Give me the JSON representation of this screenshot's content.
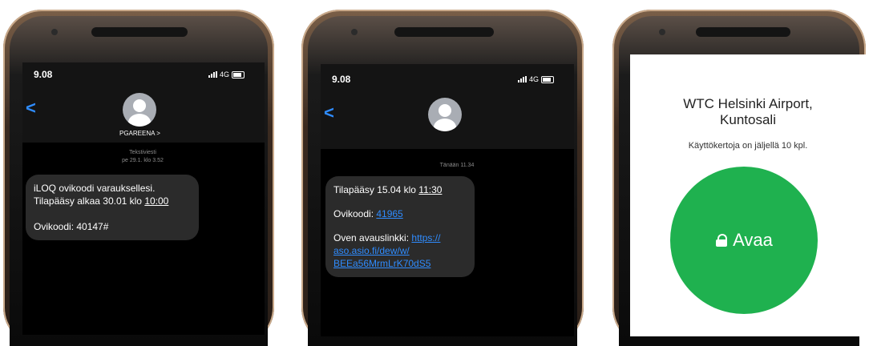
{
  "phones": [
    {
      "time": "9.08",
      "network": "4G",
      "back": "<",
      "sender": "PGAREENA >",
      "meta_line1": "Tekstiviesti",
      "meta_line2": "pe 29.1. klo 3.52",
      "message": {
        "line1": "iLOQ ovikoodi varauksellesi.",
        "line2_prefix": "Tilapääsy alkaa 30.01 klo ",
        "line2_time": "10:00",
        "line3": "Ovikoodi: 40147#"
      }
    },
    {
      "time": "9.08",
      "network": "4G",
      "back": "<",
      "meta_line1": "Tänään 11.34",
      "message": {
        "access_prefix": "Tilapääsy 15.04 klo ",
        "access_time": "11:30",
        "code_label": "Ovikoodi: ",
        "code_value": "41965",
        "link_label": "Oven avauslinkki: ",
        "link_line1": "https://",
        "link_line2": "aso.asio.fi/dew/w/",
        "link_line3": "BEEa56MrmLrK70dS5"
      }
    },
    {
      "title_line1": "WTC Helsinki Airport,",
      "title_line2": "Kuntosali",
      "subtitle": "Käyttökertoja on jäljellä 10 kpl.",
      "button_label": "Avaa",
      "button_icon": "lock-icon",
      "button_color": "#1fb14f"
    }
  ]
}
